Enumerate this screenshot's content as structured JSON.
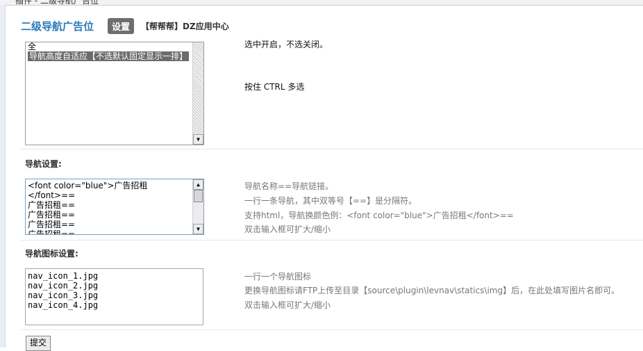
{
  "breadcrumb": "插件 - 二级导航广告位",
  "header": {
    "title": "二级导航广告位",
    "tab_label": "设置",
    "links": "【帮帮帮】DZ应用中心"
  },
  "option_select": {
    "items": [
      "全",
      "导航高度自适应【不选默认固定显示一排】"
    ],
    "help_top": "选中开启，不选关闭。",
    "help_main": "按住 CTRL 多选"
  },
  "nav_settings": {
    "label": "导航设置:",
    "lines": [
      "<font color=\"blue\">广告招租",
      "</font>==",
      "广告招租==",
      "广告招租==",
      "广告招租==",
      "广告招租=="
    ],
    "help": [
      "导航名称==导航链接。",
      "一行一条导航，其中双等号【==】是分隔符。",
      "支持html，导航换颜色例：<font color=\"blue\">广告招租</font>==",
      "双击输入框可扩大/缩小"
    ]
  },
  "nav_icons": {
    "label": "导航图标设置:",
    "lines": [
      "nav_icon_1.jpg",
      "nav_icon_2.jpg",
      "nav_icon_3.jpg",
      "nav_icon_4.jpg"
    ],
    "help": [
      "一行一个导航图标",
      "更换导航图标请FTP上传至目录【source\\plugin\\levnav\\statics\\img】后，在此处填写图片名即可。",
      "双击输入框可扩大/缩小"
    ]
  },
  "submit_label": "提交"
}
